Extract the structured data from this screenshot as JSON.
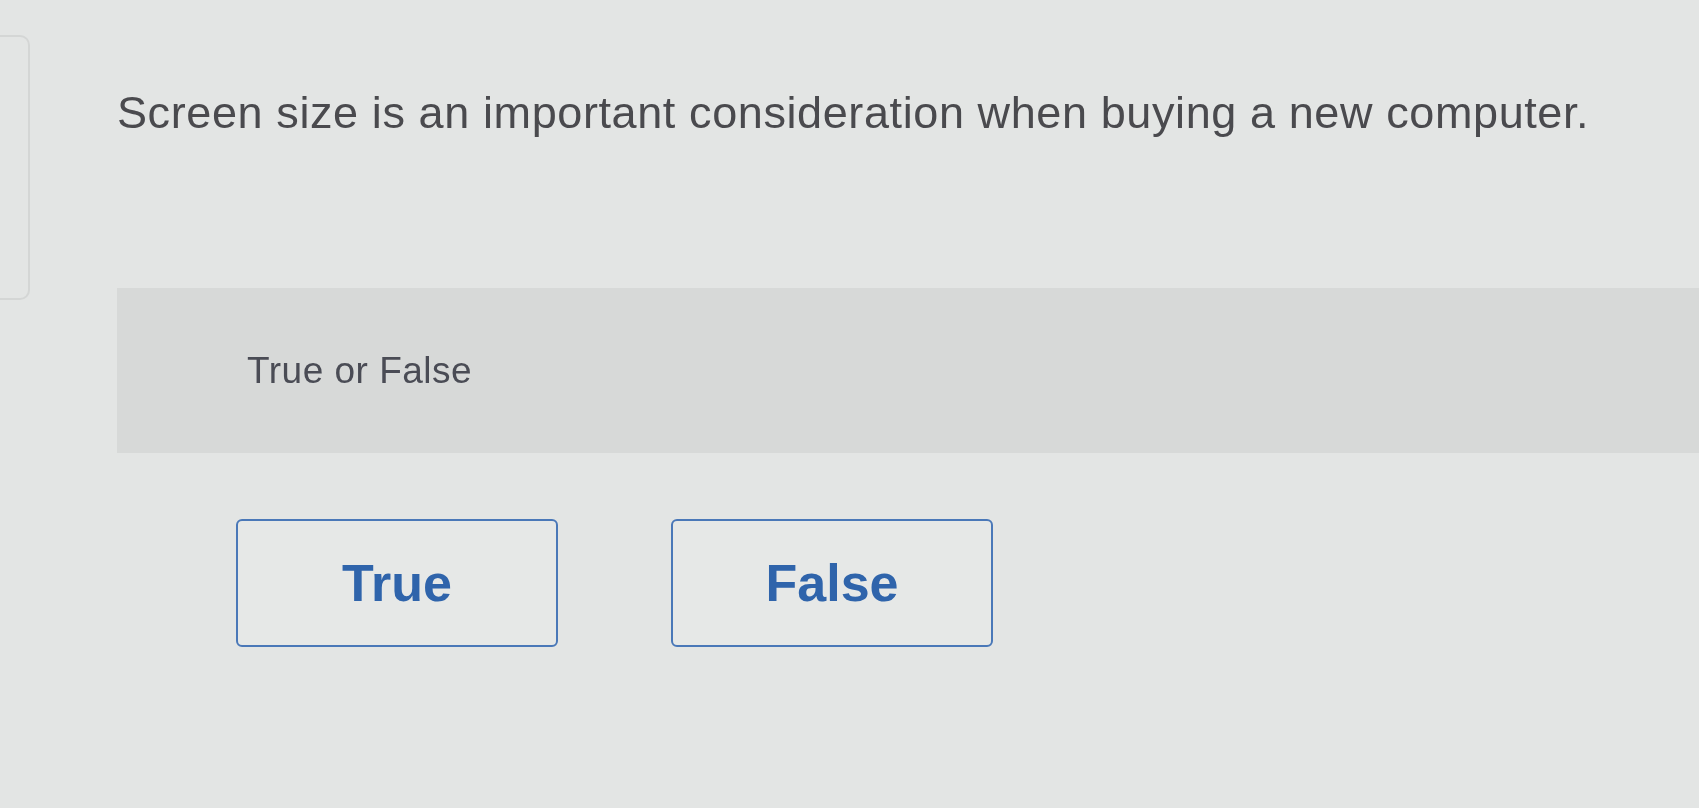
{
  "question": {
    "text": "Screen size is an important consideration when buying a new computer."
  },
  "prompt": {
    "text": "True or False"
  },
  "options": [
    {
      "label": "True",
      "selected": false
    },
    {
      "label": "False",
      "selected": false
    }
  ]
}
